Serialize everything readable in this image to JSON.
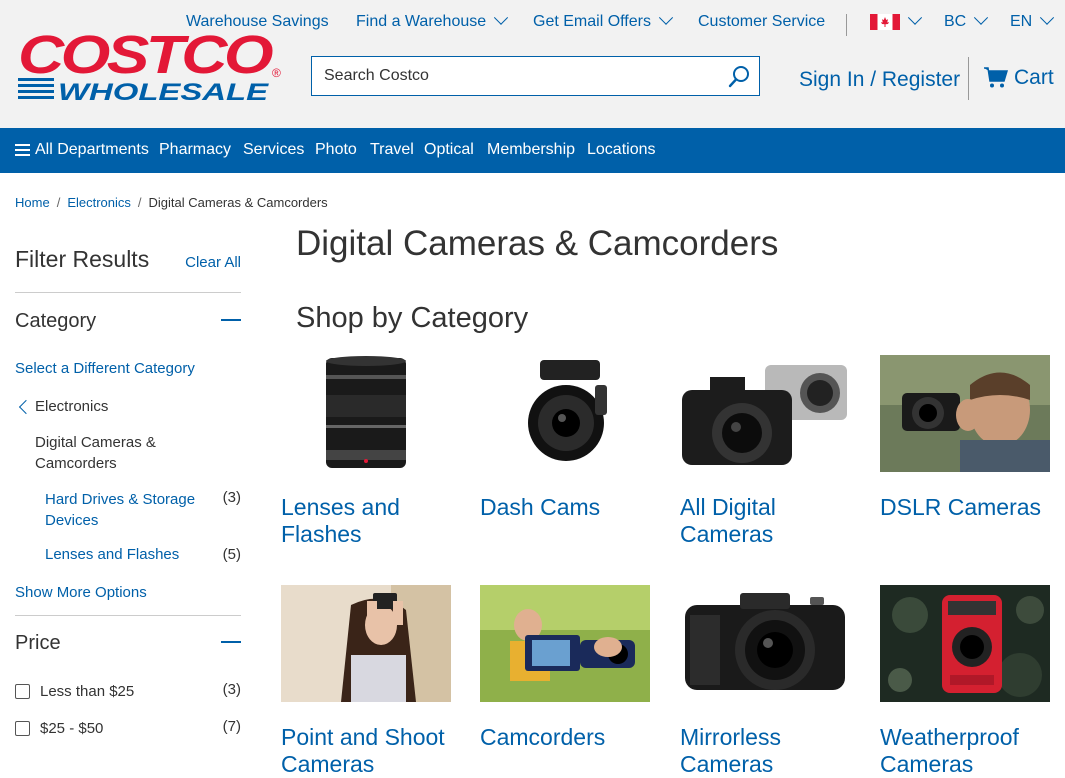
{
  "header": {
    "top_links": [
      "Warehouse Savings",
      "Find a Warehouse",
      "Get Email Offers",
      "Customer Service"
    ],
    "region": "BC",
    "language": "EN",
    "search_placeholder": "Search Costco",
    "signin_label": "Sign In / Register",
    "cart_label": "Cart",
    "logo_text": "COSTCO WHOLESALE"
  },
  "mainnav": {
    "all_departments": "All Departments",
    "items": [
      "Pharmacy",
      "Services",
      "Photo",
      "Travel",
      "Optical",
      "Membership",
      "Locations"
    ]
  },
  "breadcrumb": {
    "home": "Home",
    "electronics": "Electronics",
    "current": "Digital Cameras & Camcorders"
  },
  "sidebar": {
    "title": "Filter Results",
    "clear_all": "Clear All",
    "category_title": "Category",
    "select_different": "Select a Different Category",
    "parent_category": "Electronics",
    "current_category": "Digital Cameras & Camcorders",
    "subcategories": [
      {
        "label": "Hard Drives & Storage Devices",
        "count": "(3)"
      },
      {
        "label": "Lenses and Flashes",
        "count": "(5)"
      }
    ],
    "show_more": "Show More Options",
    "price_title": "Price",
    "price_options": [
      {
        "label": "Less than $25",
        "count": "(3)"
      },
      {
        "label": "$25 - $50",
        "count": "(7)"
      }
    ]
  },
  "main": {
    "title": "Digital Cameras & Camcorders",
    "shop_by": "Shop by Category",
    "tiles": [
      {
        "label": "Lenses and Flashes"
      },
      {
        "label": "Dash Cams"
      },
      {
        "label": "All Digital Cameras"
      },
      {
        "label": "DSLR Cameras"
      },
      {
        "label": "Point and Shoot Cameras"
      },
      {
        "label": "Camcorders"
      },
      {
        "label": "Mirrorless Cameras"
      },
      {
        "label": "Weatherproof Cameras"
      }
    ]
  },
  "colors": {
    "brand_blue": "#0060a9",
    "brand_red": "#e31837",
    "header_bg": "#f2f2f2"
  }
}
